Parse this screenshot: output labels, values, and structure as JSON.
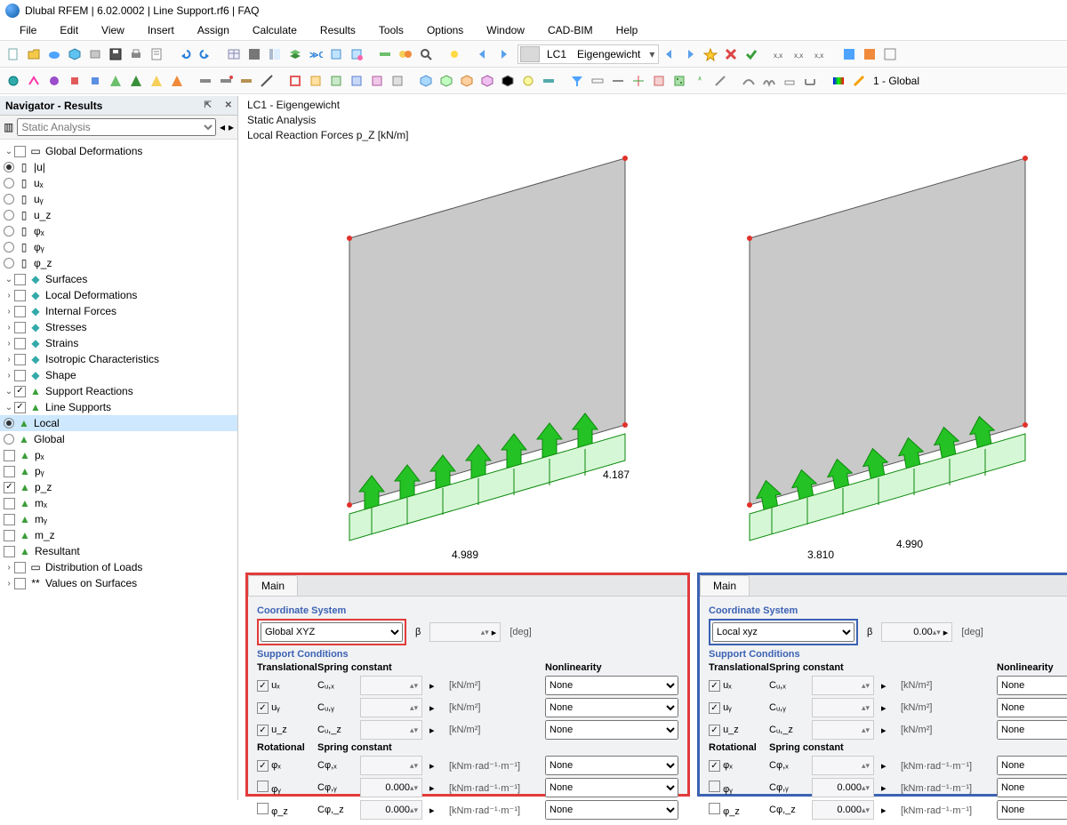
{
  "title": "Dlubal RFEM | 6.02.0002 | Line Support.rf6 | FAQ",
  "menu": [
    "File",
    "Edit",
    "View",
    "Insert",
    "Assign",
    "Calculate",
    "Results",
    "Tools",
    "Options",
    "Window",
    "CAD-BIM",
    "Help"
  ],
  "lc": {
    "code": "LC1",
    "desc": "Eigengewicht"
  },
  "global_tag": "1 - Global",
  "navigator": {
    "title": "Navigator - Results",
    "filter": "Static Analysis",
    "root1": "Global Deformations",
    "gd": [
      "|u|",
      "uₓ",
      "uᵧ",
      "u_z",
      "φₓ",
      "φᵧ",
      "φ_z"
    ],
    "surfaces": "Surfaces",
    "surf_items": [
      "Local Deformations",
      "Internal Forces",
      "Stresses",
      "Strains",
      "Isotropic Characteristics",
      "Shape"
    ],
    "reactions": "Support Reactions",
    "ls": "Line Supports",
    "ls_items": [
      "Local",
      "Global",
      "pₓ",
      "pᵧ",
      "p_z",
      "mₓ",
      "mᵧ",
      "m_z",
      "Resultant"
    ],
    "dist": "Distribution of Loads",
    "vos": "Values on Surfaces"
  },
  "vp": {
    "l1": "LC1 - Eigengewicht",
    "l2": "Static Analysis",
    "l3": "Local Reaction Forces p_Z [kN/m]",
    "left_vals": {
      "a": "4.989",
      "b": "4.187"
    },
    "right_vals": {
      "a": "3.810",
      "b": "4.990"
    }
  },
  "panel": {
    "tab": "Main",
    "cs_label": "Coordinate System",
    "beta": "β",
    "beta_unit": "[deg]",
    "beta_val": "0.00",
    "global_cs": "Global XYZ",
    "local_cs": "Local xyz",
    "sc": "Support Conditions",
    "trans": "Translational",
    "rot": "Rotational",
    "spring": "Spring constant",
    "nonlin": "Nonlinearity",
    "none": "None",
    "zero": "0.000",
    "cux": "Cᵤ,ₓ",
    "cuy": "Cᵤ,ᵧ",
    "cuz": "Cᵤ,_z",
    "cphx": "Cφ,ₓ",
    "cphy": "Cφ,ᵧ",
    "cphz": "Cφ,_z",
    "kn": "[kN/m²]",
    "knm": "[kNm·rad⁻¹·m⁻¹]",
    "ux": "uₓ",
    "uy": "uᵧ",
    "uz": "u_z",
    "phx": "φₓ",
    "phy": "φᵧ",
    "phz": "φ_z",
    "ux2": "uₓ",
    "uy2": "uᵧ",
    "uz2": "u_z",
    "phx2": "φₓ",
    "phy2": "φᵧ",
    "phz2": "φ_z"
  }
}
